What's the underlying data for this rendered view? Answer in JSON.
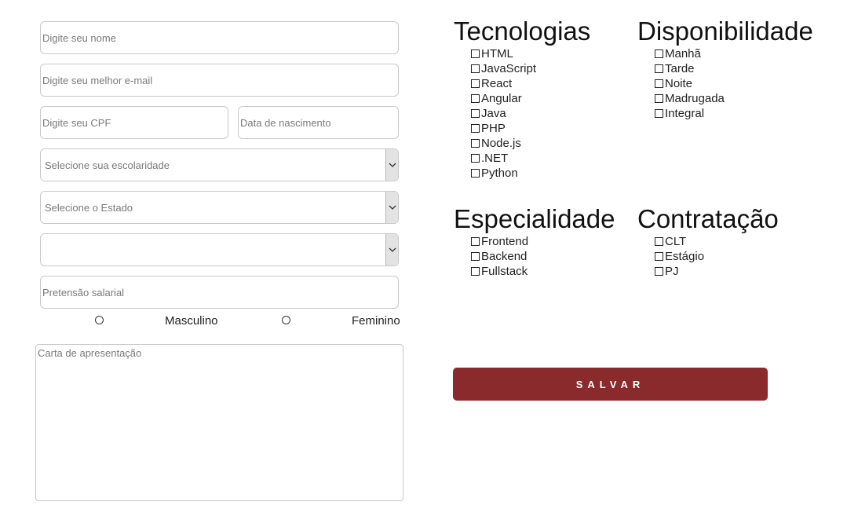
{
  "form": {
    "name_placeholder": "Digite seu nome",
    "email_placeholder": "Digite seu melhor e-mail",
    "cpf_placeholder": "Digite seu CPF",
    "birth_placeholder": "Data de nascimento",
    "education_select": "Selecione sua escolaridade",
    "state_select": "Selecione o Estado",
    "city_select": "",
    "salary_placeholder": "Pretensão salarial",
    "gender_options": [
      "Masculino",
      "Feminino"
    ],
    "letter_placeholder": "Carta de apresentação"
  },
  "groups": {
    "tecnologias": {
      "title": "Tecnologias",
      "items": [
        "HTML",
        "JavaScript",
        "React",
        "Angular",
        "Java",
        "PHP",
        "Node.js",
        ".NET",
        "Python"
      ]
    },
    "disponibilidade": {
      "title": "Disponibilidade",
      "items": [
        "Manhã",
        "Tarde",
        "Noite",
        "Madrugada",
        "Integral"
      ]
    },
    "especialidade": {
      "title": "Especialidade",
      "items": [
        "Frontend",
        "Backend",
        "Fullstack"
      ]
    },
    "contratacao": {
      "title": "Contratação",
      "items": [
        "CLT",
        "Estágio",
        "PJ"
      ]
    }
  },
  "save_button": {
    "label": "SALVAR",
    "color": "#8b2a2c"
  },
  "icons": {
    "select_arrow": "chevron-down-icon",
    "checkbox": "checkbox-icon",
    "radio": "radio-icon"
  }
}
